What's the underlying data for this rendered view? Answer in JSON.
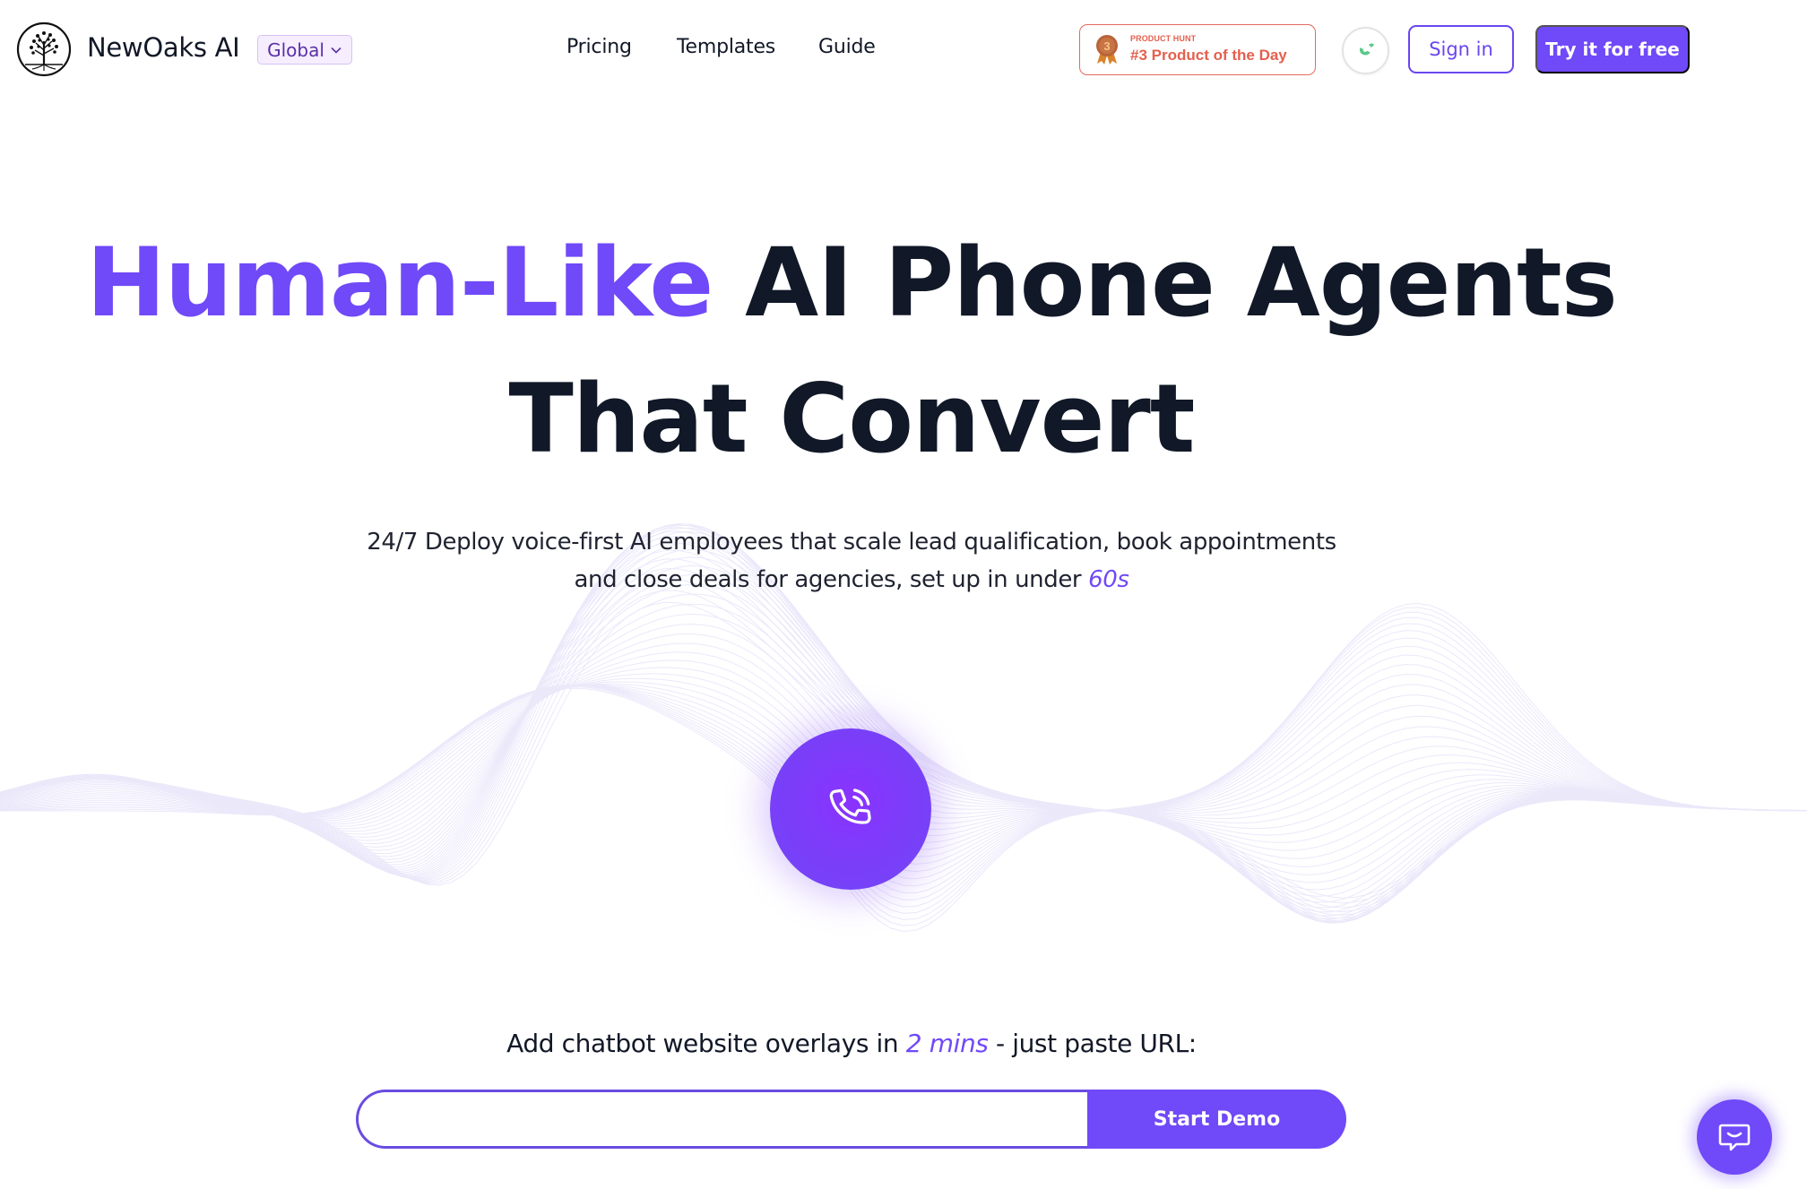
{
  "header": {
    "brand_name": "NewOaks AI",
    "region_selector": {
      "selected": "Global",
      "icon": "chevron-down-icon"
    },
    "nav_links": [
      {
        "label": "Pricing"
      },
      {
        "label": "Templates"
      },
      {
        "label": "Guide"
      }
    ],
    "product_hunt_badge": {
      "eyebrow": "PRODUCT HUNT",
      "title": "#3 Product of the Day",
      "medal_number": "3",
      "color": "#e4604e"
    },
    "call_button_icon": "phone-icon",
    "sign_in_label": "Sign in",
    "try_free_label": "Try it for free"
  },
  "hero": {
    "title_accent": "Human-Like",
    "title_rest": "AI Phone Agents That Convert",
    "subtitle_line1": "24/7 Deploy voice-first AI employees that scale lead qualification, book appointments",
    "subtitle_line2_prefix": "and close deals for agencies, set up in under ",
    "subtitle_accent": "60s",
    "call_button_icon": "phone-ringing-icon"
  },
  "demo": {
    "label_prefix": "Add chatbot website overlays in ",
    "label_accent": "2 mins",
    "label_suffix": " - just paste URL:",
    "url_input_value": "",
    "url_input_placeholder": "",
    "start_button_label": "Start Demo"
  },
  "chat_widget": {
    "icon": "chat-smile-icon"
  },
  "colors": {
    "accent": "#7049f8",
    "text": "#111827",
    "badge": "#e4604e",
    "phone_green": "#5dc88a",
    "wave": "#eeecfb"
  }
}
